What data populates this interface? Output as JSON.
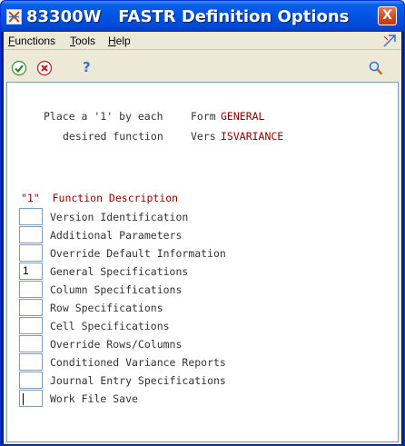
{
  "window": {
    "title_code": "83300W",
    "title_name": "FASTR Definition Options",
    "close_glyph": "X"
  },
  "menubar": {
    "items": [
      {
        "label": "Functions",
        "accel": "F"
      },
      {
        "label": "Tools",
        "accel": "T"
      },
      {
        "label": "Help",
        "accel": "H"
      }
    ]
  },
  "toolbar": {
    "ok_icon": "check-icon",
    "cancel_icon": "cancel-icon",
    "help_glyph": "?",
    "find_icon": "magnifier-icon"
  },
  "form": {
    "instruction_line1": "Place a '1' by each",
    "instruction_line2": "desired function",
    "form_label": "Form",
    "form_value": "GENERAL",
    "vers_label": "Vers",
    "vers_value": "ISVARIANCE",
    "column_header": "\"1\"  Function Description",
    "options": [
      {
        "value": "",
        "label": "Version Identification"
      },
      {
        "value": "",
        "label": "Additional Parameters"
      },
      {
        "value": "",
        "label": "Override Default Information"
      },
      {
        "value": "1",
        "label": "General Specifications"
      },
      {
        "value": "",
        "label": "Column Specifications"
      },
      {
        "value": "",
        "label": "Row Specifications"
      },
      {
        "value": "",
        "label": "Cell Specifications"
      },
      {
        "value": "",
        "label": "Override Rows/Columns"
      },
      {
        "value": "",
        "label": "Conditioned Variance Reports"
      },
      {
        "value": "",
        "label": "Journal Entry Specifications"
      },
      {
        "value": "",
        "label": "Work File Save"
      }
    ]
  },
  "colors": {
    "titlebar": "#0054e3",
    "label_red": "#8b0000",
    "text_gray": "#333333",
    "field_border": "#7f9db9"
  }
}
